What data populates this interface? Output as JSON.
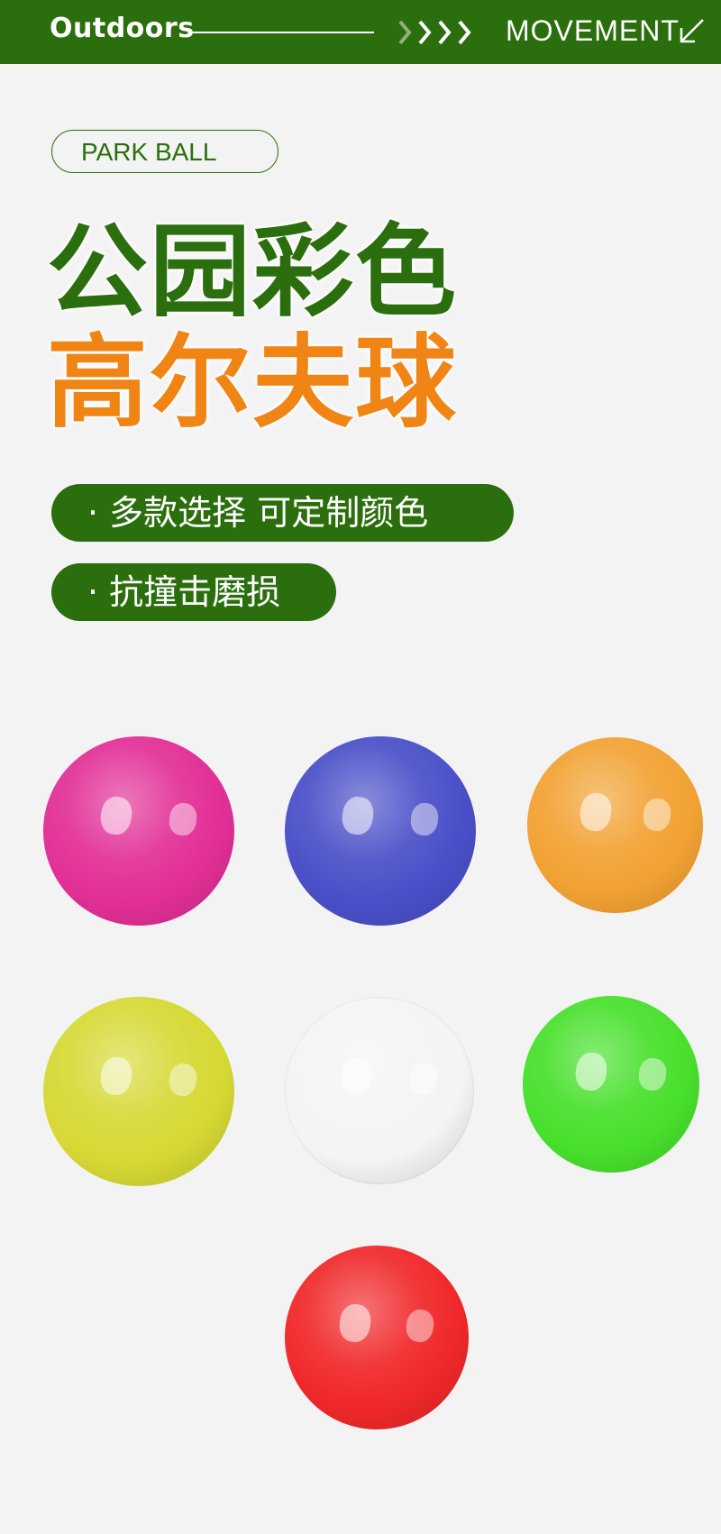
{
  "header": {
    "brand": "Outdoors",
    "section": "MOVEMENT",
    "icons": [
      "chevrons-right-icon",
      "arrow-down-left-icon"
    ],
    "background_color": "#2b6e0d"
  },
  "badge": {
    "label": "PARK BALL"
  },
  "title": {
    "line1": "公园彩色",
    "line2": "高尔夫球",
    "line1_color": "#2b6e0d",
    "line2_color": "#f08414"
  },
  "features": [
    {
      "label": "· 多款选择 可定制颜色"
    },
    {
      "label": "· 抗撞击磨损"
    }
  ],
  "balls": [
    {
      "color": "pink",
      "hex": "#e22f96"
    },
    {
      "color": "blue",
      "hex": "#4a4fc8"
    },
    {
      "color": "orange",
      "hex": "#f2a233"
    },
    {
      "color": "yellow-green",
      "hex": "#d6d934"
    },
    {
      "color": "white",
      "hex": "#f4f4f4"
    },
    {
      "color": "green",
      "hex": "#48e02c"
    },
    {
      "color": "red",
      "hex": "#f0282a"
    }
  ]
}
